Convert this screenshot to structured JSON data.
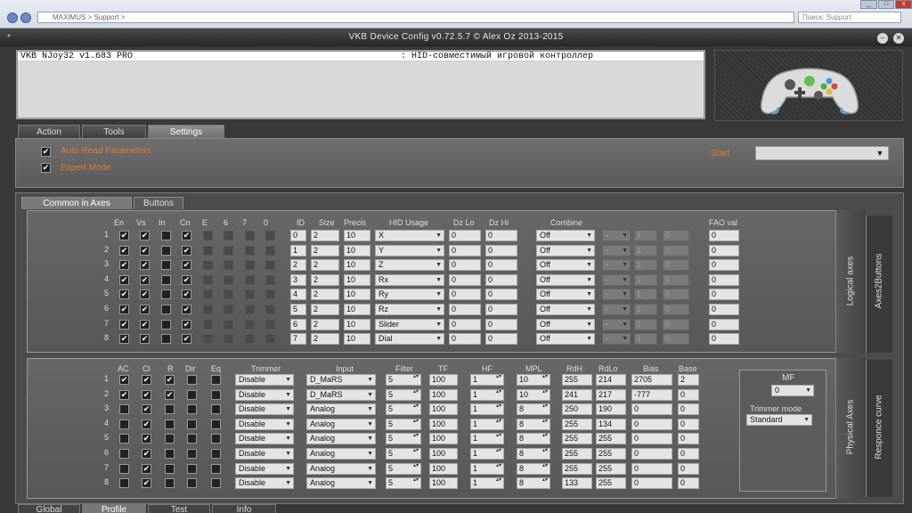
{
  "browser": {
    "address": "MAXIMUS > Support >",
    "search_placeholder": "Поиск: Support",
    "min": "_",
    "max": "□",
    "close": "x"
  },
  "app": {
    "title": "VKB Device Config v0.72.5.7 © Alex Oz 2013-2015",
    "device_name": "VKB NJoy32   v1.683 PRO",
    "device_desc": ": HID-совместимый игровой контроллер"
  },
  "main_tabs": [
    "Action",
    "Tools",
    "Settings"
  ],
  "settings": {
    "auto_read": "Auto Read Parameters",
    "expert_mode": "Expert Mode",
    "start_label": "Start",
    "start_value": ""
  },
  "sub_tabs": [
    "Common in Axes",
    "Buttons"
  ],
  "logical": {
    "headers": [
      "En",
      "Vs",
      "In",
      "Cn",
      "E",
      "6",
      "7",
      "0",
      "ID",
      "Size",
      "Precis",
      "HID Usage",
      "Dz Lo",
      "Dz Hi",
      "Combine",
      "FAO val"
    ],
    "side_a": "Logical axes",
    "side_b": "Axes2Buttons",
    "rows": [
      {
        "n": "1",
        "en": true,
        "vs": true,
        "in": false,
        "cn": true,
        "id": "0",
        "size": "2",
        "prec": "10",
        "usage": "X",
        "dzlo": "0",
        "dzhi": "0",
        "comb": "Off",
        "c2": "-",
        "c3": "1",
        "c4": "0",
        "fao": "0"
      },
      {
        "n": "2",
        "en": true,
        "vs": true,
        "in": false,
        "cn": true,
        "id": "1",
        "size": "2",
        "prec": "10",
        "usage": "Y",
        "dzlo": "0",
        "dzhi": "0",
        "comb": "Off",
        "c2": "-",
        "c3": "1",
        "c4": "0",
        "fao": "0"
      },
      {
        "n": "3",
        "en": true,
        "vs": true,
        "in": false,
        "cn": true,
        "id": "2",
        "size": "2",
        "prec": "10",
        "usage": "Z",
        "dzlo": "0",
        "dzhi": "0",
        "comb": "Off",
        "c2": "-",
        "c3": "1",
        "c4": "0",
        "fao": "0"
      },
      {
        "n": "4",
        "en": true,
        "vs": true,
        "in": false,
        "cn": true,
        "id": "3",
        "size": "2",
        "prec": "10",
        "usage": "Rx",
        "dzlo": "0",
        "dzhi": "0",
        "comb": "Off",
        "c2": "-",
        "c3": "1",
        "c4": "0",
        "fao": "0"
      },
      {
        "n": "5",
        "en": true,
        "vs": true,
        "in": false,
        "cn": true,
        "id": "4",
        "size": "2",
        "prec": "10",
        "usage": "Ry",
        "dzlo": "0",
        "dzhi": "0",
        "comb": "Off",
        "c2": "-",
        "c3": "1",
        "c4": "0",
        "fao": "0"
      },
      {
        "n": "6",
        "en": true,
        "vs": true,
        "in": false,
        "cn": true,
        "id": "5",
        "size": "2",
        "prec": "10",
        "usage": "Rz",
        "dzlo": "0",
        "dzhi": "0",
        "comb": "Off",
        "c2": "-",
        "c3": "1",
        "c4": "0",
        "fao": "0"
      },
      {
        "n": "7",
        "en": true,
        "vs": true,
        "in": false,
        "cn": true,
        "id": "6",
        "size": "2",
        "prec": "10",
        "usage": "Slider",
        "dzlo": "0",
        "dzhi": "0",
        "comb": "Off",
        "c2": "-",
        "c3": "1",
        "c4": "0",
        "fao": "0"
      },
      {
        "n": "8",
        "en": true,
        "vs": true,
        "in": false,
        "cn": true,
        "id": "7",
        "size": "2",
        "prec": "10",
        "usage": "Dial",
        "dzlo": "0",
        "dzhi": "0",
        "comb": "Off",
        "c2": "-",
        "c3": "1",
        "c4": "0",
        "fao": "0"
      }
    ]
  },
  "physical": {
    "headers": [
      "AC",
      "Cl",
      "R",
      "Dir",
      "Eq",
      "Trimmer",
      "Input",
      "Filter",
      "TF",
      "HF",
      "MPL",
      "RdH",
      "RdLo",
      "Bias",
      "Base"
    ],
    "side_a": "Physical Axes",
    "side_b": "Responce curve",
    "mf_label": "MF",
    "mf_value": "0",
    "trimmer_mode_label": "Trimmer mode",
    "trimmer_mode_value": "Standard",
    "rows": [
      {
        "n": "1",
        "ac": true,
        "cl": true,
        "r": true,
        "dir": false,
        "eq": false,
        "trim": "Disable",
        "input": "D_MaRS",
        "filter": "5",
        "tf": "100",
        "hf": "1",
        "mpl": "10",
        "rdh": "255",
        "rdlo": "214",
        "bias": "2705",
        "base": "2"
      },
      {
        "n": "2",
        "ac": true,
        "cl": true,
        "r": true,
        "dir": false,
        "eq": false,
        "trim": "Disable",
        "input": "D_MaRS",
        "filter": "5",
        "tf": "100",
        "hf": "1",
        "mpl": "10",
        "rdh": "241",
        "rdlo": "217",
        "bias": "-777",
        "base": "0"
      },
      {
        "n": "3",
        "ac": false,
        "cl": true,
        "r": false,
        "dir": false,
        "eq": false,
        "trim": "Disable",
        "input": "Analog",
        "filter": "5",
        "tf": "100",
        "hf": "1",
        "mpl": "8",
        "rdh": "250",
        "rdlo": "190",
        "bias": "0",
        "base": "0"
      },
      {
        "n": "4",
        "ac": false,
        "cl": true,
        "r": false,
        "dir": false,
        "eq": false,
        "trim": "Disable",
        "input": "Analog",
        "filter": "5",
        "tf": "100",
        "hf": "1",
        "mpl": "8",
        "rdh": "255",
        "rdlo": "134",
        "bias": "0",
        "base": "0"
      },
      {
        "n": "5",
        "ac": false,
        "cl": true,
        "r": false,
        "dir": false,
        "eq": false,
        "trim": "Disable",
        "input": "Analog",
        "filter": "5",
        "tf": "100",
        "hf": "1",
        "mpl": "8",
        "rdh": "255",
        "rdlo": "255",
        "bias": "0",
        "base": "0"
      },
      {
        "n": "6",
        "ac": false,
        "cl": true,
        "r": false,
        "dir": false,
        "eq": false,
        "trim": "Disable",
        "input": "Analog",
        "filter": "5",
        "tf": "100",
        "hf": "1",
        "mpl": "8",
        "rdh": "255",
        "rdlo": "255",
        "bias": "0",
        "base": "0"
      },
      {
        "n": "7",
        "ac": false,
        "cl": true,
        "r": false,
        "dir": false,
        "eq": false,
        "trim": "Disable",
        "input": "Analog",
        "filter": "5",
        "tf": "100",
        "hf": "1",
        "mpl": "8",
        "rdh": "255",
        "rdlo": "255",
        "bias": "0",
        "base": "0"
      },
      {
        "n": "8",
        "ac": false,
        "cl": true,
        "r": false,
        "dir": false,
        "eq": false,
        "trim": "Disable",
        "input": "Analog",
        "filter": "5",
        "tf": "100",
        "hf": "1",
        "mpl": "8",
        "rdh": "133",
        "rdlo": "255",
        "bias": "0",
        "base": "0"
      }
    ]
  },
  "bottom_tabs": [
    "Global",
    "Profile",
    "Test",
    "Info"
  ],
  "colors": {
    "accent": "#e07830"
  }
}
